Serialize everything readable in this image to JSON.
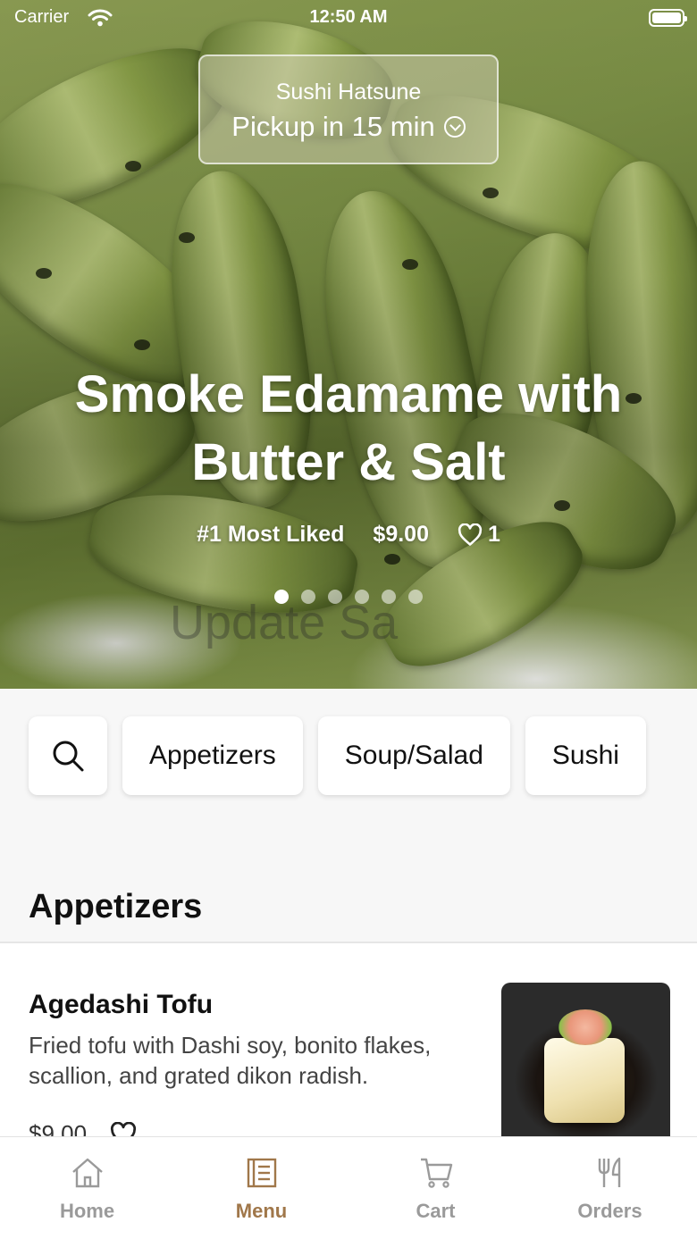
{
  "status_bar": {
    "carrier": "Carrier",
    "time": "12:50 AM"
  },
  "pickup": {
    "restaurant": "Sushi Hatsune",
    "pickup_time": "Pickup in 15 min"
  },
  "hero": {
    "title": "Smoke Edamame with Butter & Salt",
    "badge": "#1 Most Liked",
    "price": "$9.00",
    "likes": "1",
    "ghost_text": "Update Sa",
    "carousel_pages": 6,
    "carousel_active": 1
  },
  "categories": {
    "search_icon": "search-icon",
    "items": [
      "Appetizers",
      "Soup/Salad",
      "Sushi"
    ]
  },
  "section": {
    "title": "Appetizers"
  },
  "menu_item": {
    "name": "Agedashi Tofu",
    "description": "Fried tofu with Dashi soy, bonito flakes, scallion, and grated dikon radish.",
    "price": "$9.00"
  },
  "tabbar": {
    "tabs": [
      {
        "label": "Home",
        "icon": "home-icon"
      },
      {
        "label": "Menu",
        "icon": "menu-icon"
      },
      {
        "label": "Cart",
        "icon": "cart-icon"
      },
      {
        "label": "Orders",
        "icon": "utensils-icon"
      }
    ],
    "active": "Menu",
    "active_color": "#a0774a",
    "inactive_color": "#9a9a9a"
  }
}
